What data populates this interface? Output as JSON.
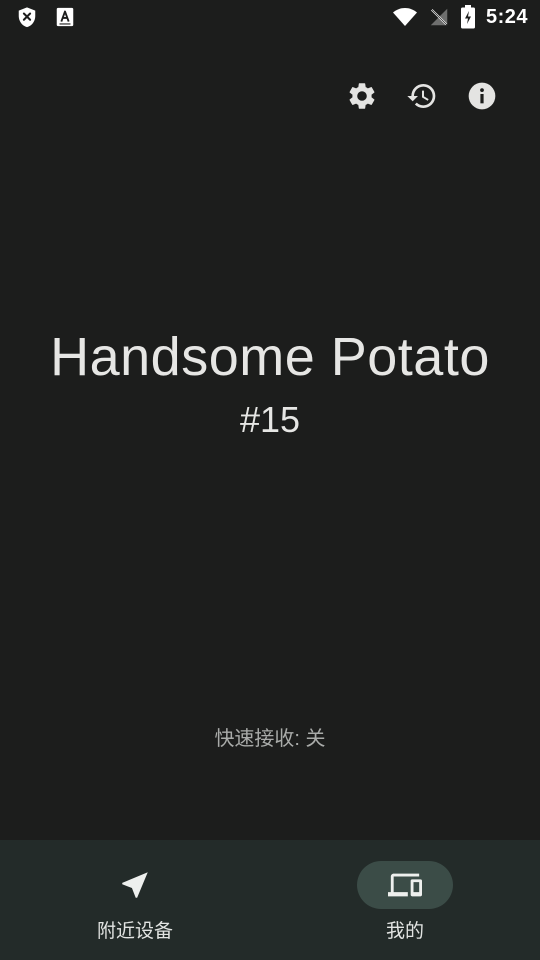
{
  "status_bar": {
    "time": "5:24",
    "left_icons": [
      "shield-x-icon",
      "font-a-icon"
    ],
    "right_icons": [
      "wifi-icon",
      "no-signal-icon",
      "battery-charging-icon"
    ]
  },
  "toolbar": {
    "actions": [
      "settings-icon",
      "history-icon",
      "info-icon"
    ]
  },
  "device": {
    "name": "Handsome Potato",
    "number": "#15"
  },
  "quick_receive": {
    "text": "快速接收: 关"
  },
  "bottom_nav": {
    "items": [
      {
        "label": "附近设备",
        "icon": "send-arrow-icon",
        "active": false
      },
      {
        "label": "我的",
        "icon": "devices-icon",
        "active": true
      }
    ]
  },
  "colors": {
    "background": "#1c1d1c",
    "nav_background": "#232b29",
    "nav_active_pill": "#3b4c47",
    "text_primary": "#e6e6e4",
    "text_secondary": "#a9aba9"
  }
}
